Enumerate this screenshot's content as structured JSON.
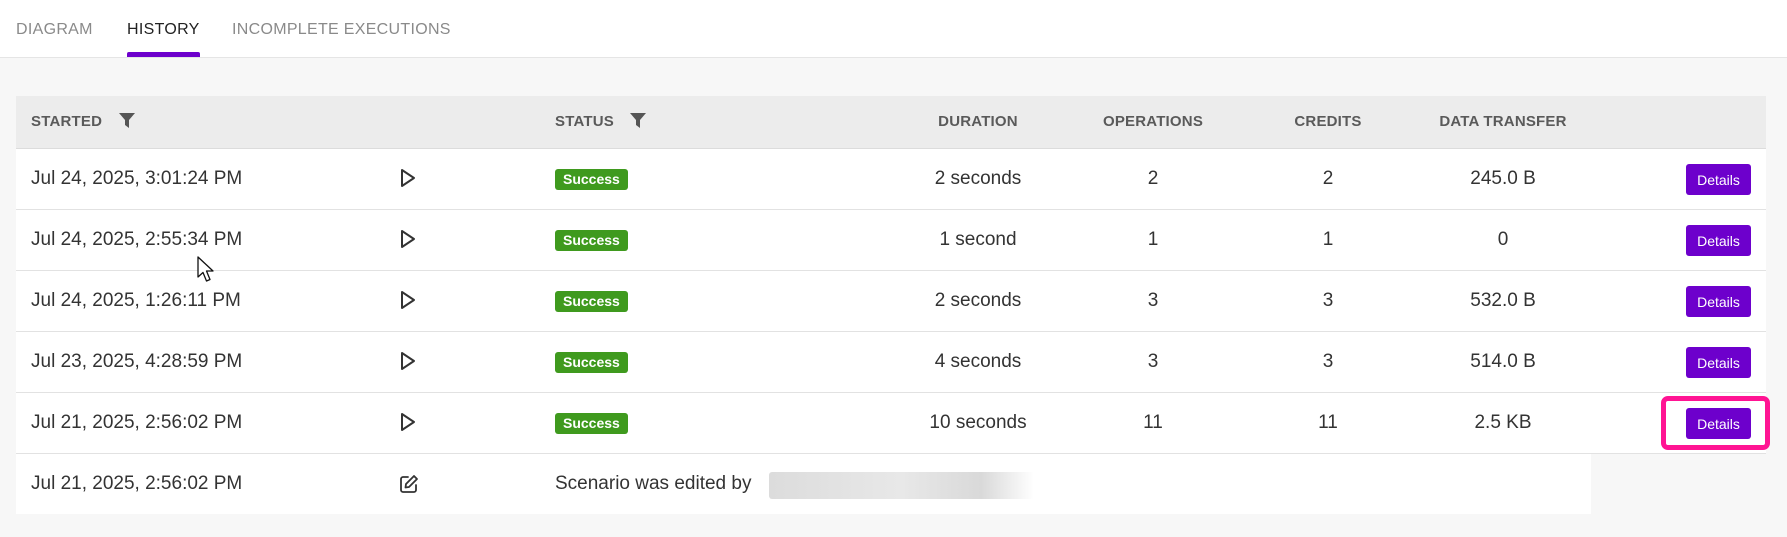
{
  "tabs": [
    {
      "label": "DIAGRAM",
      "active": false
    },
    {
      "label": "HISTORY",
      "active": true
    },
    {
      "label": "INCOMPLETE EXECUTIONS",
      "active": false
    }
  ],
  "table": {
    "headers": {
      "started": "STARTED",
      "status": "STATUS",
      "duration": "DURATION",
      "operations": "OPERATIONS",
      "credits": "CREDITS",
      "data_transfer": "DATA TRANSFER"
    },
    "rows": [
      {
        "started": "Jul 24, 2025, 3:01:24 PM",
        "status": "Success",
        "duration": "2 seconds",
        "operations": "2",
        "credits": "2",
        "data_transfer": "245.0 B",
        "action": "Details"
      },
      {
        "started": "Jul 24, 2025, 2:55:34 PM",
        "status": "Success",
        "duration": "1 second",
        "operations": "1",
        "credits": "1",
        "data_transfer": "0",
        "action": "Details"
      },
      {
        "started": "Jul 24, 2025, 1:26:11 PM",
        "status": "Success",
        "duration": "2 seconds",
        "operations": "3",
        "credits": "3",
        "data_transfer": "532.0 B",
        "action": "Details"
      },
      {
        "started": "Jul 23, 2025, 4:28:59 PM",
        "status": "Success",
        "duration": "4 seconds",
        "operations": "3",
        "credits": "3",
        "data_transfer": "514.0 B",
        "action": "Details"
      },
      {
        "started": "Jul 21, 2025, 2:56:02 PM",
        "status": "Success",
        "duration": "10 seconds",
        "operations": "11",
        "credits": "11",
        "data_transfer": "2.5 KB",
        "action": "Details"
      }
    ],
    "edit_row": {
      "started": "Jul 21, 2025, 2:56:02 PM",
      "message": "Scenario was edited by"
    }
  },
  "icons": {
    "filter": "filter-icon",
    "play": "play-icon",
    "edit": "edit-icon"
  },
  "colors": {
    "accent": "#6d00cc",
    "success": "#3f9a1e",
    "highlight": "#ff1493"
  }
}
